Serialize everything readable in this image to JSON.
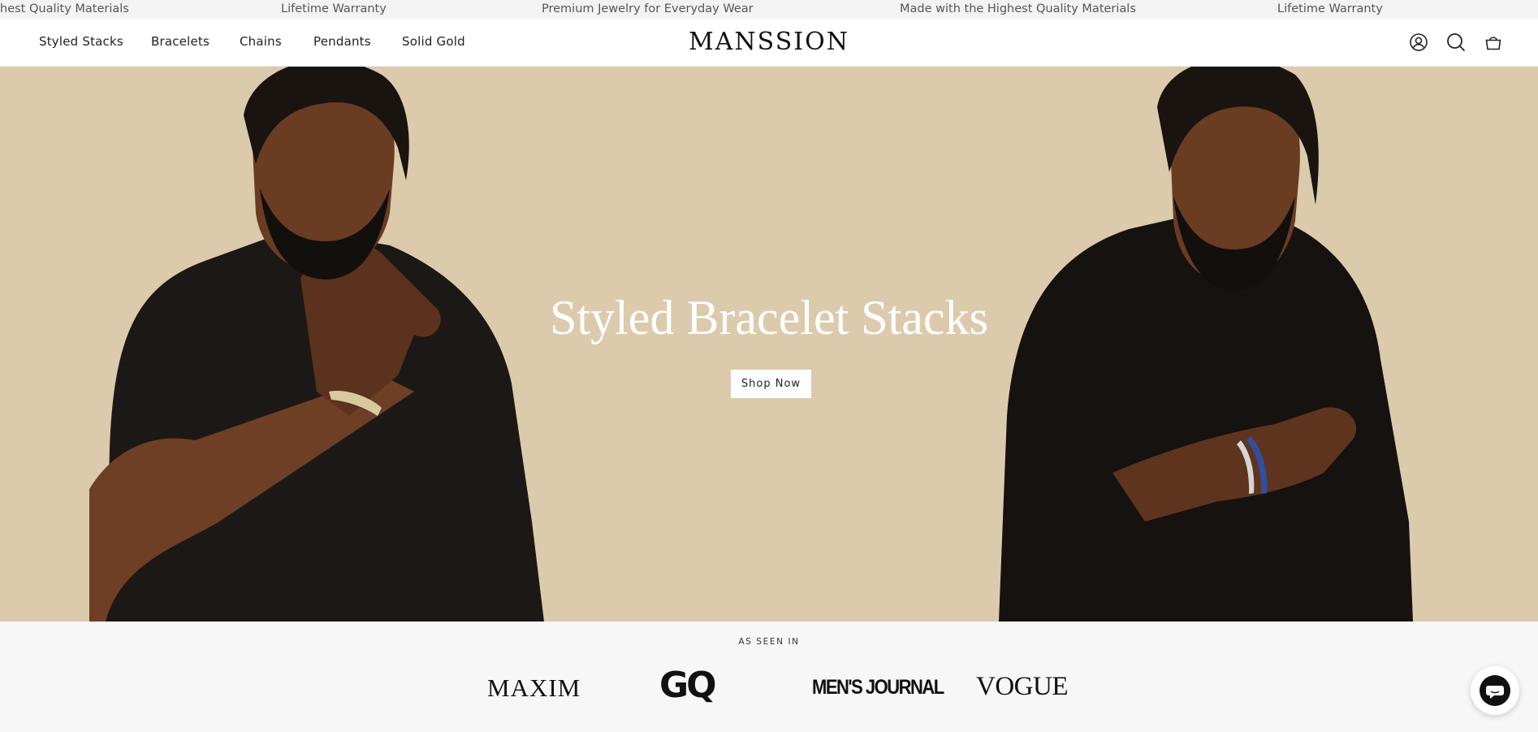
{
  "announcement": {
    "messages": [
      "hest Quality Materials",
      "Lifetime Warranty",
      "Premium Jewelry for Everyday Wear",
      "Made with the Highest Quality Materials",
      "Lifetime Warranty"
    ]
  },
  "header": {
    "nav": [
      "Styled Stacks",
      "Bracelets",
      "Chains",
      "Pendants",
      "Solid Gold"
    ],
    "logo": "MANSSION",
    "icons": [
      "account-icon",
      "search-icon",
      "cart-icon"
    ]
  },
  "hero": {
    "title": "Styled Bracelet Stacks",
    "cta": "Shop Now",
    "background_color": "#dccaad"
  },
  "press": {
    "label": "AS SEEN IN",
    "logos": [
      "MAXIM",
      "GQ",
      "MEN'S JOURNAL",
      "VOGUE"
    ]
  },
  "chat": {
    "icon": "chat-icon"
  }
}
